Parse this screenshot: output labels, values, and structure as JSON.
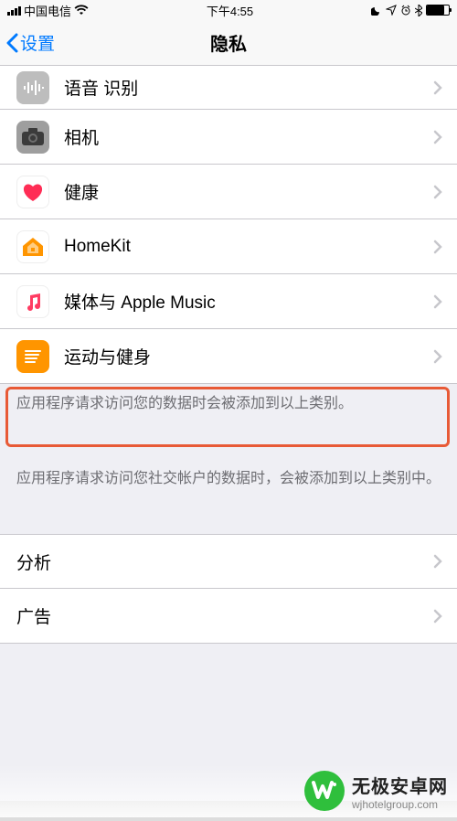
{
  "status": {
    "carrier": "中国电信",
    "time": "下午4:55"
  },
  "nav": {
    "back": "设置",
    "title": "隐私"
  },
  "rows": {
    "speech": {
      "label": "语音 识别"
    },
    "camera": {
      "label": "相机"
    },
    "health": {
      "label": "健康"
    },
    "homekit": {
      "label": "HomeKit"
    },
    "music": {
      "label": "媒体与 Apple Music"
    },
    "motion": {
      "label": "运动与健身"
    },
    "analysis": {
      "label": "分析"
    },
    "ads": {
      "label": "广告"
    }
  },
  "notes": {
    "n1": "应用程序请求访问您的数据时会被添加到以上类别。",
    "n2": "应用程序请求访问您社交帐户的数据时，会被添加到以上类别中。"
  },
  "watermark": {
    "logo": "W",
    "title": "无极安卓网",
    "sub": "wjhotelgroup.com"
  }
}
